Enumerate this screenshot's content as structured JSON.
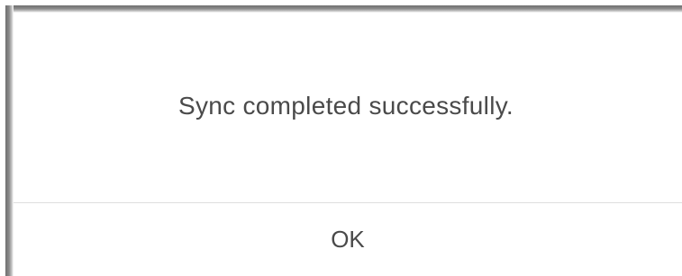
{
  "dialog": {
    "message": "Sync completed successfully.",
    "ok_label": "OK"
  },
  "colors": {
    "text": "#4a4a4a",
    "divider": "#dedede",
    "shadow": "#6f6f6f",
    "background": "#ffffff"
  }
}
